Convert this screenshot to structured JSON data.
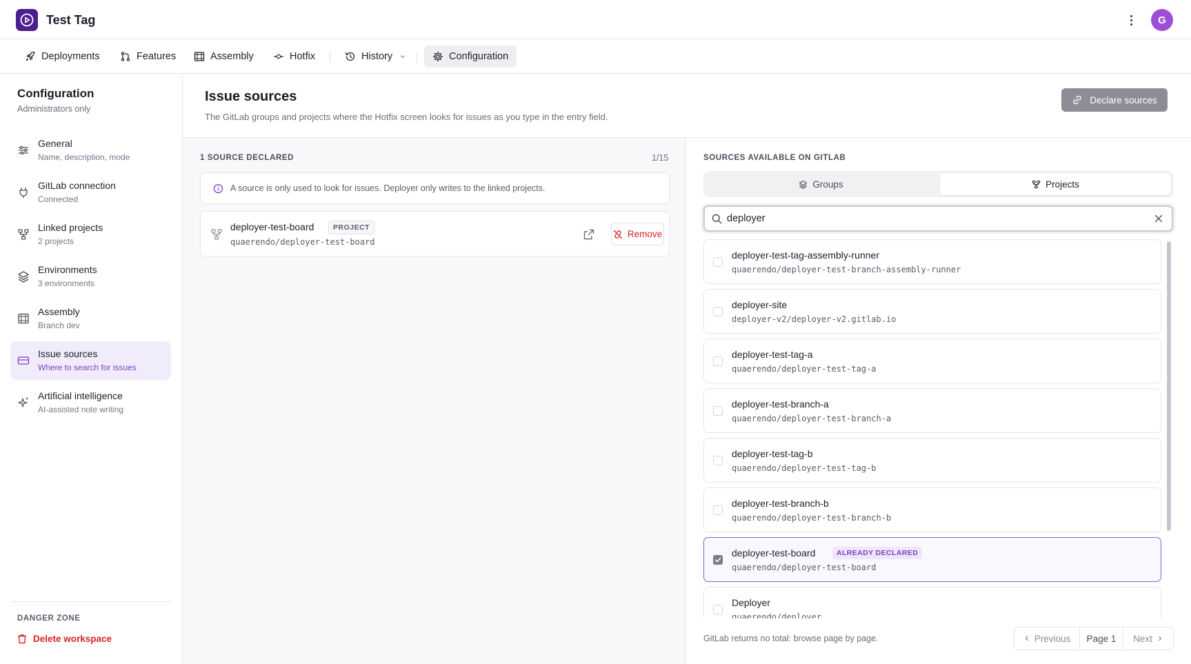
{
  "app": {
    "title": "Test Tag",
    "avatar_initial": "G",
    "accent": "#4b1f8f"
  },
  "nav": {
    "items": [
      {
        "label": "Deployments",
        "icon": "rocket-icon"
      },
      {
        "label": "Features",
        "icon": "merge-icon"
      },
      {
        "label": "Assembly",
        "icon": "frame-icon"
      },
      {
        "label": "Hotfix",
        "icon": "commit-icon"
      },
      {
        "label": "History",
        "icon": "history-icon"
      },
      {
        "label": "Configuration",
        "icon": "gear-icon",
        "active": true
      }
    ]
  },
  "sidebar": {
    "title": "Configuration",
    "subtitle": "Administrators only",
    "items": [
      {
        "label": "General",
        "desc": "Name, description, mode",
        "icon": "sliders-icon"
      },
      {
        "label": "GitLab connection",
        "desc": "Connected",
        "icon": "plug-icon"
      },
      {
        "label": "Linked projects",
        "desc": "2 projects",
        "icon": "nodes-icon"
      },
      {
        "label": "Environments",
        "desc": "3 environments",
        "icon": "layers-icon"
      },
      {
        "label": "Assembly",
        "desc": "Branch dev",
        "icon": "frame-icon"
      },
      {
        "label": "Issue sources",
        "desc": "Where to search for issues",
        "icon": "ticket-icon",
        "active": true
      },
      {
        "label": "Artificial intelligence",
        "desc": "AI-assisted note writing",
        "icon": "sparkles-icon"
      }
    ],
    "danger_title": "DANGER ZONE",
    "delete_label": "Delete workspace",
    "danger_color": "#d32626"
  },
  "main": {
    "title": "Issue sources",
    "description": "The GitLab groups and projects where the Hotfix screen looks for issues as you type in the entry field.",
    "declare_button": "Declare sources"
  },
  "declared": {
    "label": "1 SOURCE DECLARED",
    "count": "1/15",
    "info": "A source is only used to look for issues. Deployer only writes to the linked projects.",
    "sources": [
      {
        "name": "deployer-test-board",
        "badge": "PROJECT",
        "path": "quaerendo/deployer-test-board",
        "remove_label": "Remove"
      }
    ]
  },
  "available": {
    "label": "SOURCES AVAILABLE ON GITLAB",
    "tabs": [
      {
        "label": "Groups",
        "icon": "layers-icon"
      },
      {
        "label": "Projects",
        "icon": "nodes-icon",
        "active": true
      }
    ],
    "search_value": "deployer",
    "results": [
      {
        "name": "deployer-test-tag-assembly-runner",
        "path": "quaerendo/deployer-test-branch-assembly-runner"
      },
      {
        "name": "deployer-site",
        "path": "deployer-v2/deployer-v2.gitlab.io"
      },
      {
        "name": "deployer-test-tag-a",
        "path": "quaerendo/deployer-test-tag-a"
      },
      {
        "name": "deployer-test-branch-a",
        "path": "quaerendo/deployer-test-branch-a"
      },
      {
        "name": "deployer-test-tag-b",
        "path": "quaerendo/deployer-test-tag-b"
      },
      {
        "name": "deployer-test-branch-b",
        "path": "quaerendo/deployer-test-branch-b"
      },
      {
        "name": "deployer-test-board",
        "path": "quaerendo/deployer-test-board",
        "badge": "ALREADY DECLARED",
        "declared": true
      },
      {
        "name": "Deployer",
        "path": "quaerendo/deployer"
      }
    ],
    "footnote": "GitLab returns no total: browse page by page.",
    "pager": {
      "previous": "Previous",
      "page": "Page 1",
      "next": "Next"
    }
  }
}
